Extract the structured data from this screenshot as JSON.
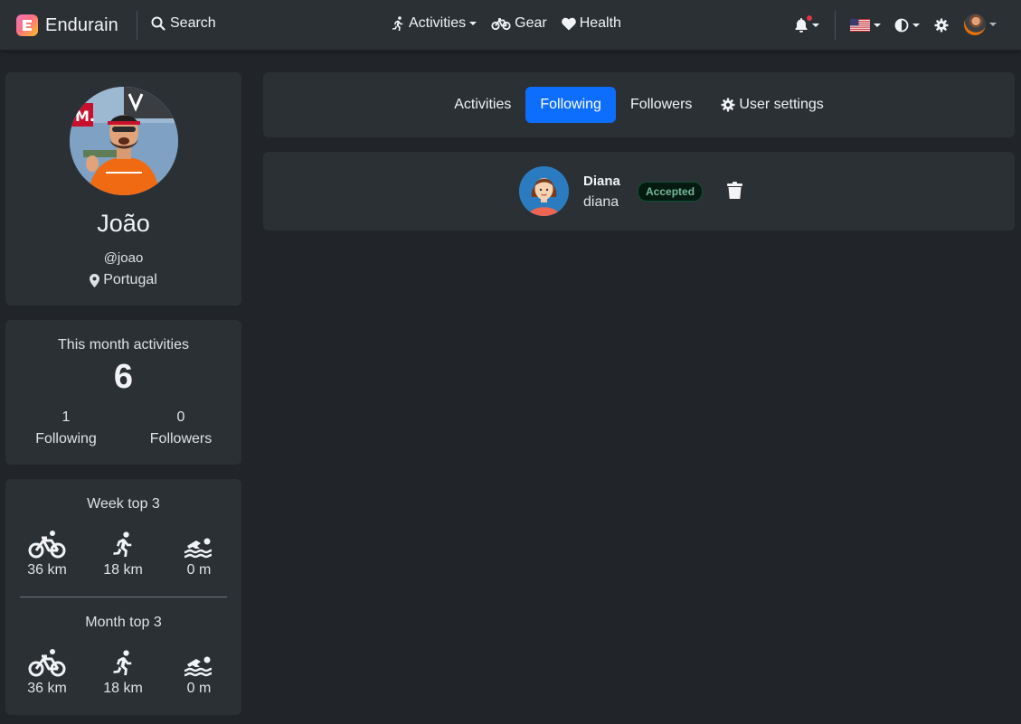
{
  "navbar": {
    "brand": "Endurain",
    "search_label": "Search",
    "activities_label": "Activities",
    "gear_label": "Gear",
    "health_label": "Health"
  },
  "profile": {
    "name": "João",
    "handle": "@joao",
    "location": "Portugal"
  },
  "stats": {
    "title": "This month activities",
    "count": "6",
    "following_count": "1",
    "following_label": "Following",
    "followers_count": "0",
    "followers_label": "Followers"
  },
  "tops": {
    "week_title": "Week top 3",
    "week": [
      {
        "icon": "bike-icon",
        "value": "36 km"
      },
      {
        "icon": "run-icon",
        "value": "18 km"
      },
      {
        "icon": "swim-icon",
        "value": "0 m"
      }
    ],
    "month_title": "Month top 3",
    "month": [
      {
        "icon": "bike-icon",
        "value": "36 km"
      },
      {
        "icon": "run-icon",
        "value": "18 km"
      },
      {
        "icon": "swim-icon",
        "value": "0 m"
      }
    ]
  },
  "tabs": {
    "activities": "Activities",
    "following": "Following",
    "followers": "Followers",
    "settings": "User settings",
    "active": "Following"
  },
  "following_list": [
    {
      "name": "Diana",
      "username": "diana",
      "status": "Accepted"
    }
  ],
  "colors": {
    "background": "#212529",
    "card": "#2b3035",
    "accent": "#0d6efd",
    "badge_text": "#75b798",
    "notification_dot": "#dc3545"
  }
}
